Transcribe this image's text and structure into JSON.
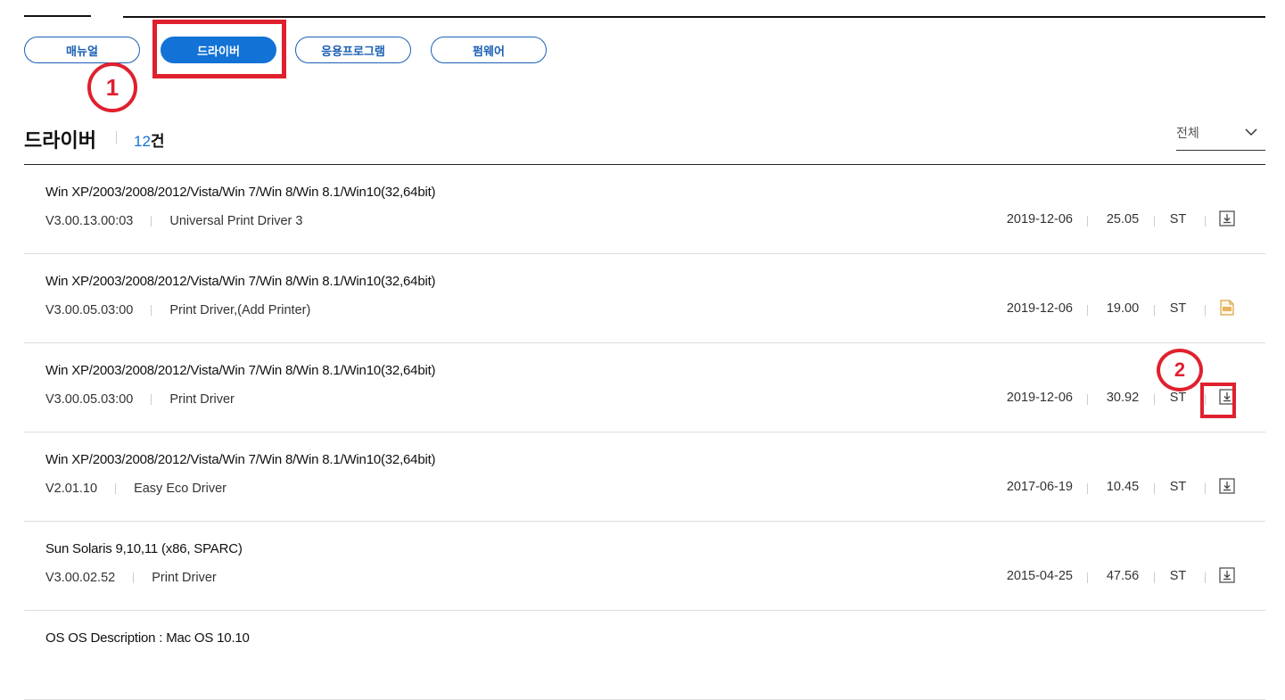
{
  "tabs": [
    {
      "label": "매뉴얼"
    },
    {
      "label": "드라이버"
    },
    {
      "label": "응용프로그램"
    },
    {
      "label": "펌웨어"
    }
  ],
  "callouts": {
    "one": "1",
    "two": "2"
  },
  "section": {
    "title": "드라이버",
    "count_num": "12",
    "count_unit": "건",
    "filter_label": "전체"
  },
  "rows": [
    {
      "title": "Win XP/2003/2008/2012/Vista/Win 7/Win 8/Win 8.1/Win10(32,64bit)",
      "version": "V3.00.13.00:03",
      "name": "Universal Print Driver 3",
      "date": "2019-12-06",
      "size": "25.05",
      "code": "ST",
      "icon": "download-icon"
    },
    {
      "title": "Win XP/2003/2008/2012/Vista/Win 7/Win 8/Win 8.1/Win10(32,64bit)",
      "version": "V3.00.05.03:00",
      "name": "Print Driver,(Add Printer)",
      "date": "2019-12-06",
      "size": "19.00",
      "code": "ST",
      "icon": "zip-icon"
    },
    {
      "title": "Win XP/2003/2008/2012/Vista/Win 7/Win 8/Win 8.1/Win10(32,64bit)",
      "version": "V3.00.05.03:00",
      "name": "Print Driver",
      "date": "2019-12-06",
      "size": "30.92",
      "code": "ST",
      "icon": "download-icon"
    },
    {
      "title": "Win XP/2003/2008/2012/Vista/Win 7/Win 8/Win 8.1/Win10(32,64bit)",
      "version": "V2.01.10",
      "name": "Easy Eco Driver",
      "date": "2017-06-19",
      "size": "10.45",
      "code": "ST",
      "icon": "download-icon"
    },
    {
      "title": "Sun Solaris 9,10,11 (x86, SPARC)",
      "version": "V3.00.02.52",
      "name": "Print Driver",
      "date": "2015-04-25",
      "size": "47.56",
      "code": "ST",
      "icon": "download-icon"
    },
    {
      "title": "OS OS Description : Mac OS 10.10"
    }
  ],
  "colors": {
    "accent": "#1272d6",
    "highlight": "#e0202e"
  }
}
